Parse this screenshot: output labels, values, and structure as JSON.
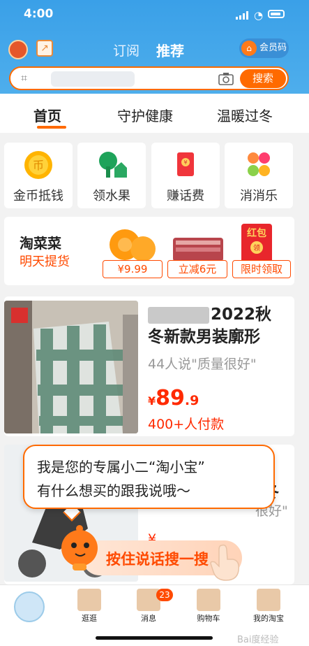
{
  "status_bar": {
    "time": "4:00"
  },
  "header": {
    "tabs": [
      {
        "label": "订阅"
      },
      {
        "label": "推荐"
      }
    ],
    "member_label": "会员码",
    "search_button": "搜索"
  },
  "category_tabs": [
    {
      "label": "首页"
    },
    {
      "label": "守护健康"
    },
    {
      "label": "温暖过冬"
    }
  ],
  "quick_entries": [
    {
      "label": "金币抵钱",
      "icon": "gold-coin-icon"
    },
    {
      "label": "领水果",
      "icon": "tree-house-icon"
    },
    {
      "label": "赚话费",
      "icon": "red-envelope-icon"
    },
    {
      "label": "消消乐",
      "icon": "candy-hearts-icon"
    }
  ],
  "taocaicai": {
    "title": "淘菜菜",
    "subtitle": "明天提货",
    "tags": [
      {
        "label": "¥9.99"
      },
      {
        "label": "立减6元"
      },
      {
        "label": "限时领取"
      }
    ],
    "envelope_text": "红包",
    "envelope_sub": "领"
  },
  "product": {
    "title_line1": "2022秋",
    "title_line2": "冬新款男装廓形",
    "reviews": "44人说\"质量很好\"",
    "price_currency": "¥",
    "price_int": "89",
    "price_dec": ".9",
    "paid": "400+人付款"
  },
  "product2": {
    "partial_title": "冬",
    "partial_reviews": "很好\"",
    "partial_price": "¥"
  },
  "assistant": {
    "line1": "我是您的专属小二“淘小宝”",
    "line2": "有什么想买的跟我说哦～",
    "voice_button": "按住说话搜一搜"
  },
  "bottom_nav": [
    {
      "label": ""
    },
    {
      "label": "逛逛"
    },
    {
      "label": "消息",
      "badge": "23"
    },
    {
      "label": "购物车"
    },
    {
      "label": "我的淘宝"
    }
  ],
  "watermark": "Bai度经验"
}
